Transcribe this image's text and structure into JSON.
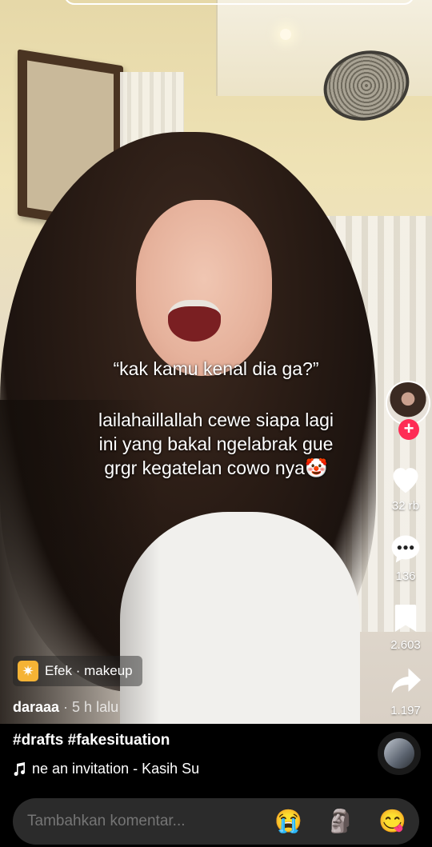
{
  "caption": {
    "quote": "“kak kamu kenal dia ga?”",
    "lines": [
      "lailahaillallah cewe siapa lagi",
      "ini yang bakal ngelabrak gue",
      "grgr kegatelan cowo nya🤡"
    ]
  },
  "rail": {
    "follow_symbol": "+",
    "likes": "32 rb",
    "comments": "136",
    "saves": "2.603",
    "shares": "1.197"
  },
  "effect": {
    "icon_glyph": "✷",
    "label": "Efek · makeup"
  },
  "author": {
    "name": "daraaa",
    "time": " · 5 h lalu"
  },
  "description": {
    "hashtags": "#drafts #fakesituation"
  },
  "music": {
    "title": "ne an invitation - Kasih Su"
  },
  "comment": {
    "placeholder": "Tambahkan komentar...",
    "emojis": [
      "😭",
      "🗿",
      "😋"
    ]
  },
  "colors": {
    "accent": "#fe2c55",
    "effect_icon": "#f5b335",
    "comment_bar": "#2b2b2b"
  }
}
